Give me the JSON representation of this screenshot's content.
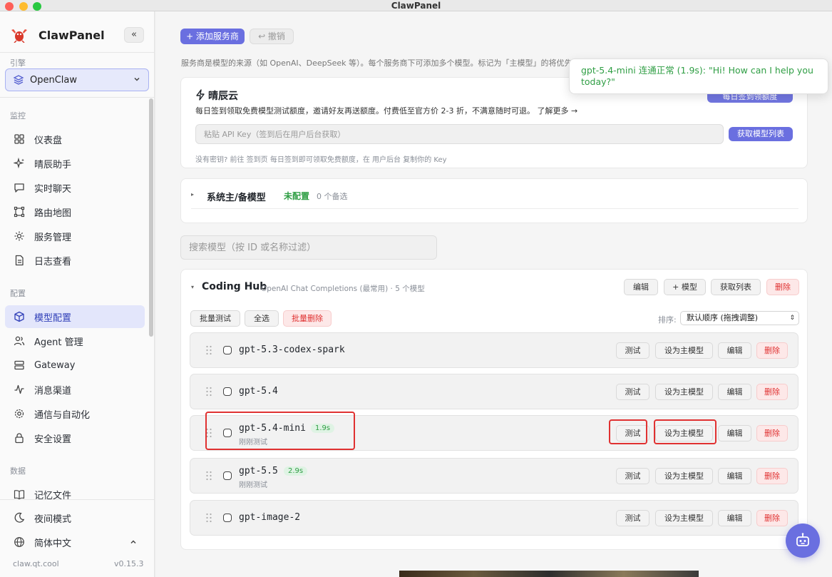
{
  "window": {
    "title": "ClawPanel"
  },
  "colors": {
    "accent": "#6a6fe0",
    "success": "#2f9e44",
    "danger": "#e03131",
    "highlight": "#e03131"
  },
  "sidebar": {
    "brand": "ClawPanel",
    "engine_label": "引擎",
    "engine_value": "OpenClaw",
    "sections": [
      {
        "label": "监控",
        "items": [
          {
            "label": "仪表盘",
            "icon": "grid-icon"
          },
          {
            "label": "晴辰助手",
            "icon": "sparkle-icon"
          },
          {
            "label": "实时聊天",
            "icon": "chat-icon"
          },
          {
            "label": "路由地图",
            "icon": "route-icon"
          },
          {
            "label": "服务管理",
            "icon": "gear-icon"
          },
          {
            "label": "日志查看",
            "icon": "file-icon"
          }
        ]
      },
      {
        "label": "配置",
        "items": [
          {
            "label": "模型配置",
            "icon": "cube-icon",
            "active": true
          },
          {
            "label": "Agent 管理",
            "icon": "users-icon"
          },
          {
            "label": "Gateway",
            "icon": "server-icon"
          },
          {
            "label": "消息渠道",
            "icon": "pulse-icon"
          },
          {
            "label": "通信与自动化",
            "icon": "settings-icon"
          },
          {
            "label": "安全设置",
            "icon": "lock-icon"
          }
        ]
      },
      {
        "label": "数据",
        "items": [
          {
            "label": "记忆文件",
            "icon": "book-icon"
          }
        ]
      }
    ],
    "bottom": [
      {
        "label": "夜间模式",
        "icon": "moon-icon"
      },
      {
        "label": "简体中文",
        "icon": "globe-icon"
      }
    ],
    "footer_url": "claw.qt.cool",
    "footer_version": "v0.15.3"
  },
  "toolbar": {
    "add_provider": "+ 添加服务商",
    "undo": "↩ 撤销",
    "hint": "服务商是模型的来源（如 OpenAI、DeepSeek 等）。每个服务商下可添加多个模型。标记为「主模型」的将优先"
  },
  "toast": {
    "message": "gpt-5.4-mini 连通正常 (1.9s): \"Hi! How can I help you today?\""
  },
  "promo": {
    "title": "晴辰云",
    "desc": "每日签到领取免费模型测试额度，邀请好友再送额度。付费低至官方价 2-3 折，不满意随时可退。 了解更多 →",
    "signin_button": "每日签到领额度",
    "api_key_placeholder": "粘贴 API Key（签到后在用户后台获取）",
    "fetch_button": "获取模型列表",
    "note": "没有密钥? 前往 签到页 每日签到即可领取免费额度，在 用户后台 复制你的 Key"
  },
  "system_model": {
    "title": "系统主/备模型",
    "status": "未配置",
    "fallback": "0 个备选"
  },
  "search": {
    "placeholder": "搜索模型（按 ID 或名称过滤）"
  },
  "provider": {
    "name": "Coding Hub",
    "meta": "OpenAI Chat Completions (最常用) · 5 个模型",
    "actions": {
      "edit": "编辑",
      "add_model": "+ 模型",
      "fetch_list": "获取列表",
      "delete": "删除"
    },
    "batch": {
      "batch_test": "批量测试",
      "select_all": "全选",
      "batch_delete": "批量删除"
    },
    "sort_label": "排序:",
    "sort_value": "默认顺序 (拖拽调整)",
    "row_actions": {
      "test": "测试",
      "set_primary": "设为主模型",
      "edit": "编辑",
      "delete": "删除"
    },
    "models": [
      {
        "name": "gpt-5.3-codex-spark",
        "latency": "",
        "tested": ""
      },
      {
        "name": "gpt-5.4",
        "latency": "",
        "tested": ""
      },
      {
        "name": "gpt-5.4-mini",
        "latency": "1.9s",
        "tested": "刚刚测试"
      },
      {
        "name": "gpt-5.5",
        "latency": "2.9s",
        "tested": "刚刚测试"
      },
      {
        "name": "gpt-image-2",
        "latency": "",
        "tested": ""
      }
    ]
  }
}
